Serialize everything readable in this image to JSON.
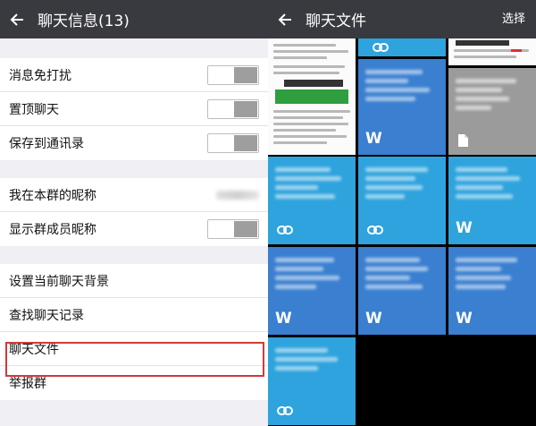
{
  "left": {
    "title": "聊天信息(13)",
    "rows": [
      {
        "label": "消息免打扰"
      },
      {
        "label": "置顶聊天"
      },
      {
        "label": "保存到通讯录"
      },
      {
        "label": "我在本群的昵称"
      },
      {
        "label": "显示群成员昵称"
      },
      {
        "label": "设置当前聊天背景"
      },
      {
        "label": "查找聊天记录"
      },
      {
        "label": "聊天文件"
      },
      {
        "label": "举报群"
      }
    ]
  },
  "right": {
    "title": "聊天文件",
    "select_label": "选择",
    "tiles": [
      {
        "kind": "screenshot",
        "icon": "screenshot-thumbnail"
      },
      {
        "kind": "link",
        "icon": "link-icon"
      },
      {
        "kind": "screenshot",
        "icon": "screenshot-thumbnail"
      },
      {
        "kind": "word",
        "icon": "word-icon",
        "icon_text": "W"
      },
      {
        "kind": "word",
        "icon": "word-icon",
        "icon_text": "W"
      },
      {
        "kind": "file",
        "icon": "file-icon"
      },
      {
        "kind": "link",
        "icon": "link-icon"
      },
      {
        "kind": "link",
        "icon": "link-icon"
      },
      {
        "kind": "word",
        "icon": "word-icon",
        "icon_text": "W"
      },
      {
        "kind": "word",
        "icon": "word-icon",
        "icon_text": "W"
      },
      {
        "kind": "word",
        "icon": "word-icon",
        "icon_text": "W"
      },
      {
        "kind": "word",
        "icon": "word-icon",
        "icon_text": "W"
      },
      {
        "kind": "link",
        "icon": "link-icon"
      }
    ]
  },
  "colors": {
    "header": "#393a3f",
    "tile_cyan": "#2ea3dd",
    "tile_blue": "#3a7fd0",
    "tile_gray": "#9b9b9b",
    "highlight": "#d23a3a"
  }
}
